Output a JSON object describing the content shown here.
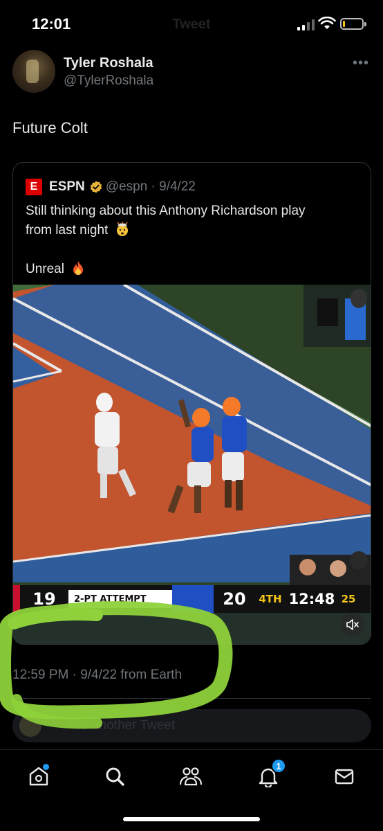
{
  "status_bar": {
    "time": "12:01",
    "nav_title": "Tweet"
  },
  "tweet": {
    "author_name": "Tyler Roshala",
    "author_handle": "@TylerRoshala",
    "text": "Future Colt",
    "timestamp": "12:59 PM · 9/4/22 from Earth"
  },
  "quote": {
    "logo_letter": "E",
    "name": "ESPN",
    "handle_date": "@espn · 9/4/22",
    "line1": "Still thinking about this Anthony Richardson play",
    "line2": "from last night",
    "line3": "Unreal"
  },
  "scoreboard": {
    "away_score": "19",
    "attempt": "2-PT ATTEMPT",
    "home_score": "20",
    "quarter": "4TH",
    "clock": "12:48",
    "play_clock": "25"
  },
  "reply": {
    "placeholder": "Add another Tweet"
  },
  "tabbar": {
    "notification_count": "1"
  },
  "colors": {
    "background": "#000000",
    "accent": "#1d9bf0",
    "secondary_text": "#71767b",
    "annotation": "#8ed13a"
  },
  "icons": [
    "more-icon",
    "verified-icon",
    "exploding-head-emoji",
    "fire-emoji",
    "mute-icon",
    "home-icon",
    "search-icon",
    "communities-icon",
    "notifications-icon",
    "messages-icon"
  ]
}
